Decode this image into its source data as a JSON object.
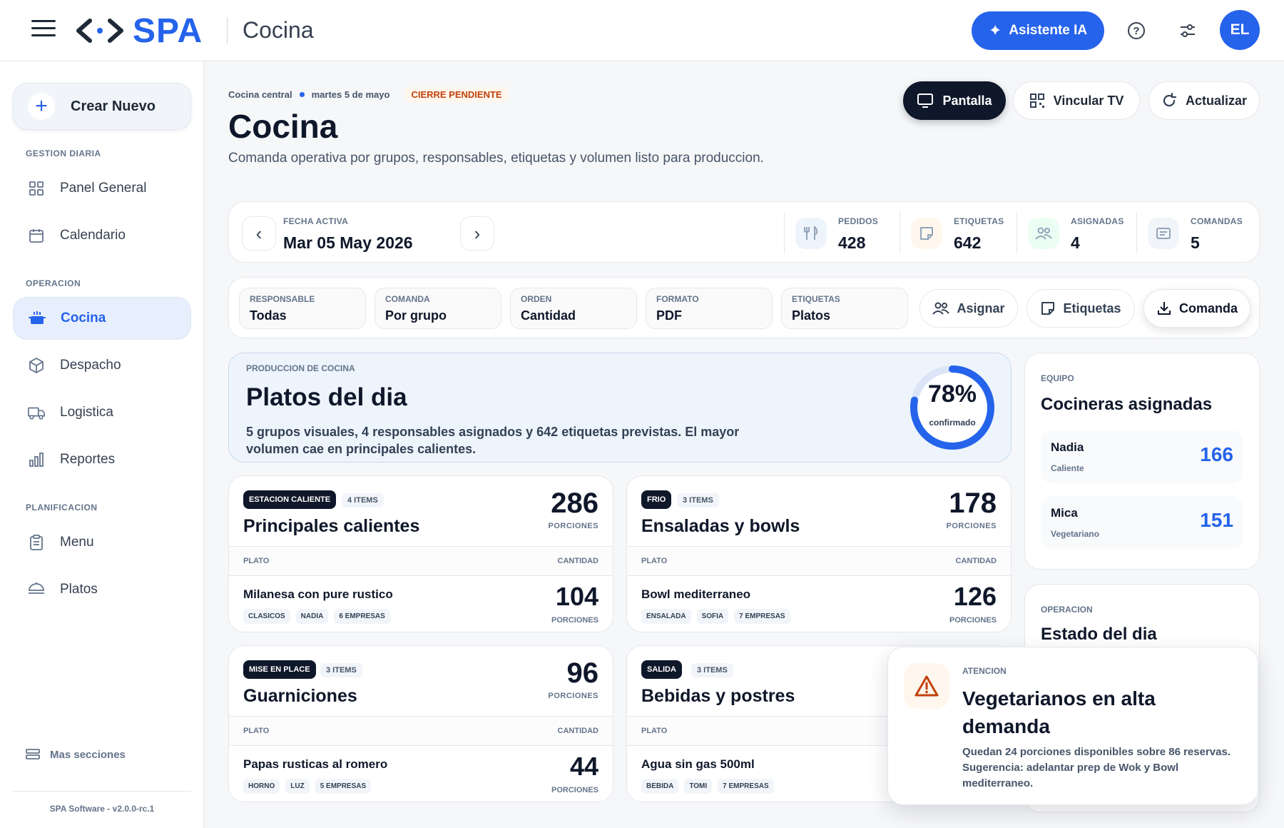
{
  "app": {
    "logo_text": "SPA",
    "section": "Cocina",
    "ai_button": "Asistente IA",
    "avatar_initials": "EL",
    "brand_color": "#2563eb"
  },
  "sidebar": {
    "create_label": "Crear Nuevo",
    "groups": [
      "GESTION DIARIA",
      "OPERACION",
      "PLANIFICACION"
    ],
    "items": [
      {
        "label": "Panel General",
        "icon": "grid-icon"
      },
      {
        "label": "Calendario",
        "icon": "calendar-icon"
      },
      {
        "label": "Cocina",
        "icon": "pot-icon",
        "active": true
      },
      {
        "label": "Despacho",
        "icon": "box-icon"
      },
      {
        "label": "Logistica",
        "icon": "truck-icon"
      },
      {
        "label": "Reportes",
        "icon": "bar-chart-icon"
      },
      {
        "label": "Menu",
        "icon": "clipboard-icon"
      },
      {
        "label": "Platos",
        "icon": "dish-icon"
      }
    ],
    "more_label": "Mas secciones",
    "version": "SPA Software - v2.0.0-rc.1"
  },
  "header": {
    "breadcrumb": [
      "Cocina central",
      "martes 5 de mayo"
    ],
    "status": "CIERRE PENDIENTE",
    "title": "Cocina",
    "subtitle": "Comanda operativa por grupos, responsables, etiquetas y volumen listo para produccion.",
    "actions": [
      "Pantalla",
      "Vincular TV",
      "Actualizar"
    ]
  },
  "date_strip": {
    "label": "FECHA ACTIVA",
    "value": "Mar 05 May 2026",
    "stats": [
      {
        "label": "PEDIDOS",
        "value": "428",
        "icon": "utensils-icon"
      },
      {
        "label": "ETIQUETAS",
        "value": "642",
        "icon": "sticker-icon"
      },
      {
        "label": "ASIGNADAS",
        "value": "4",
        "icon": "users-icon"
      },
      {
        "label": "COMANDAS",
        "value": "5",
        "icon": "ticket-icon"
      }
    ]
  },
  "filters": {
    "fields": [
      {
        "label": "RESPONSABLE",
        "value": "Todas"
      },
      {
        "label": "COMANDA",
        "value": "Por grupo"
      },
      {
        "label": "ORDEN",
        "value": "Cantidad"
      },
      {
        "label": "FORMATO",
        "value": "PDF"
      },
      {
        "label": "ETIQUETAS",
        "value": "Platos"
      }
    ],
    "buttons": [
      "Asignar",
      "Etiquetas",
      "Comanda"
    ]
  },
  "hero": {
    "kicker": "PRODUCCION DE COCINA",
    "title": "Platos del dia",
    "description": "5 grupos visuales, 4 responsables asignados y 642 etiquetas previstas. El mayor volumen cae en principales calientes.",
    "percent_label": "78%",
    "percent_value": 0.78,
    "percent_caption": "confirmado"
  },
  "groups": [
    {
      "badge": "ESTACION CALIENTE",
      "count": "4 ITEMS",
      "title": "Principales calientes",
      "total": "286",
      "unit": "PORCIONES",
      "col_plato": "PLATO",
      "col_cantidad": "CANTIDAD",
      "dish": "Milanesa con pure rustico",
      "tags": [
        "CLASICOS",
        "NADIA",
        "6 EMPRESAS"
      ],
      "qty": "104",
      "qty_unit": "PORCIONES"
    },
    {
      "badge": "FRIO",
      "count": "3 ITEMS",
      "title": "Ensaladas y bowls",
      "total": "178",
      "unit": "PORCIONES",
      "col_plato": "PLATO",
      "col_cantidad": "CANTIDAD",
      "dish": "Bowl mediterraneo",
      "tags": [
        "ENSALADA",
        "SOFIA",
        "7 EMPRESAS"
      ],
      "qty": "126",
      "qty_unit": "PORCIONES"
    },
    {
      "badge": "MISE EN PLACE",
      "count": "3 ITEMS",
      "title": "Guarniciones",
      "total": "96",
      "unit": "PORCIONES",
      "col_plato": "PLATO",
      "col_cantidad": "CANTIDAD",
      "dish": "Papas rusticas al romero",
      "tags": [
        "HORNO",
        "LUZ",
        "5 EMPRESAS"
      ],
      "qty": "44",
      "qty_unit": "PORCIONES"
    },
    {
      "badge": "SALIDA",
      "count": "3 ITEMS",
      "title": "Bebidas y postres",
      "total": "",
      "unit": "",
      "col_plato": "PLATO",
      "col_cantidad": "",
      "dish": "Agua sin gas 500ml",
      "tags": [
        "BEBIDA",
        "TOMI",
        "7 EMPRESAS"
      ],
      "qty": "",
      "qty_unit": ""
    }
  ],
  "team": {
    "kicker": "EQUIPO",
    "title": "Cocineras asignadas",
    "cooks": [
      {
        "name": "Nadia",
        "role": "Caliente",
        "value": "166"
      },
      {
        "name": "Mica",
        "role": "Vegetariano",
        "value": "151"
      }
    ]
  },
  "ops": {
    "kicker": "OPERACION",
    "title": "Estado del dia"
  },
  "alert": {
    "kicker": "ATENCION",
    "title": "Vegetarianos en alta demanda",
    "body": "Quedan 24 porciones disponibles sobre 86 reservas. Sugerencia: adelantar prep de Wok y Bowl mediterraneo.",
    "color": "#c2410c"
  }
}
